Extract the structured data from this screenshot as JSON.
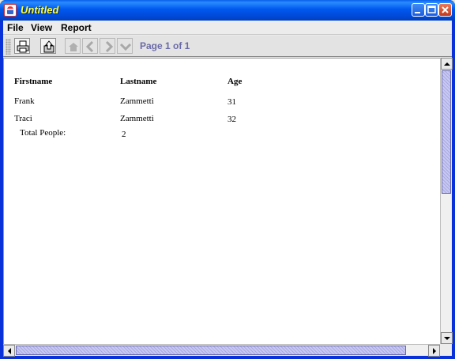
{
  "window": {
    "title": "Untitled"
  },
  "menu": {
    "items": [
      "File",
      "View",
      "Report"
    ]
  },
  "toolbar": {
    "page_label": "Page 1 of 1",
    "buttons": [
      "printer-icon",
      "export-icon",
      "first-page-icon",
      "previous-page-icon",
      "next-page-icon",
      "last-page-icon"
    ]
  },
  "report": {
    "headers": [
      "Firstname",
      "Lastname",
      "Age"
    ],
    "rows": [
      [
        "Frank",
        "Zammetti",
        "31"
      ],
      [
        "Traci",
        "Zammetti",
        "32"
      ]
    ],
    "summary": {
      "label": "Total People:",
      "value": "2"
    }
  },
  "colors": {
    "title_text": "#ffff33",
    "page_label": "#6a6aa8",
    "titlebar": "#0058ee"
  }
}
